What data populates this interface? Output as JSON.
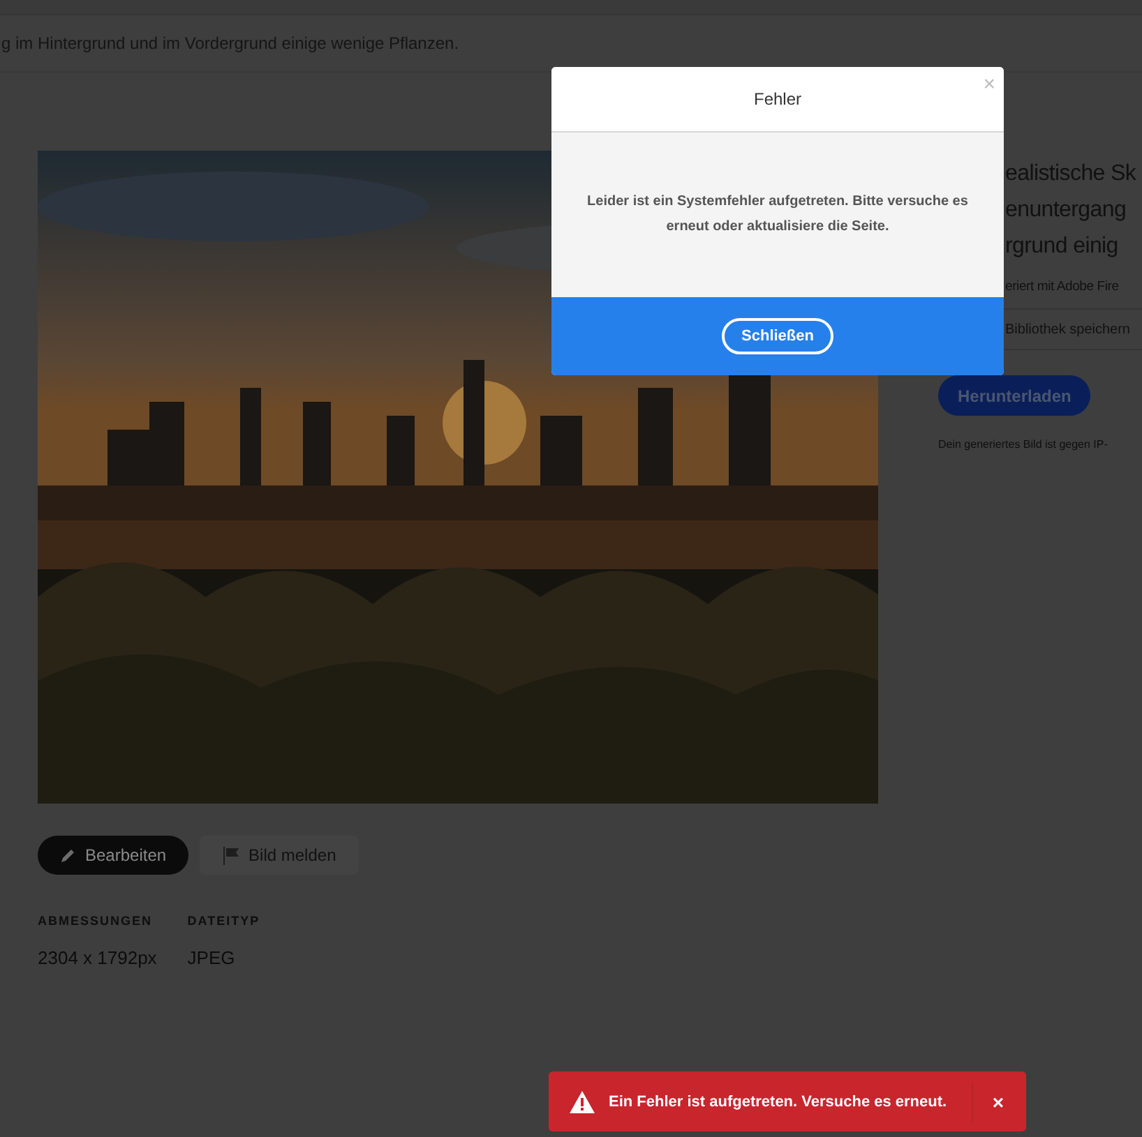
{
  "description": "g im Hintergrund und im Vordergrund einige wenige Pflanzen.",
  "actions": [
    {
      "label": "Bearbeiten",
      "kind": "primary"
    },
    {
      "label": "Bild melden",
      "kind": "secondary"
    }
  ],
  "meta": [
    {
      "label": "ABMESSUNGEN",
      "value": "2304 x 1792px"
    },
    {
      "label": "DATEITYP",
      "value": "JPEG"
    }
  ],
  "side": {
    "title_lines": [
      "ealistische Sk",
      "enuntergang",
      "rgrund einig"
    ],
    "credit": "eriert mit Adobe Fire",
    "library": "Bibliothek speichern",
    "download": "Herunterladen",
    "note": "Dein generiertes Bild ist gegen IP-"
  },
  "dialog": {
    "title": "Fehler",
    "close": "×",
    "message": "Leider ist ein Systemfehler aufgetreten. Bitte versuche es erneut oder aktualisiere die Seite.",
    "button": "Schließen"
  },
  "toast": {
    "message": "Ein Fehler ist aufgetreten. Versuche es erneut.",
    "close": "×"
  }
}
